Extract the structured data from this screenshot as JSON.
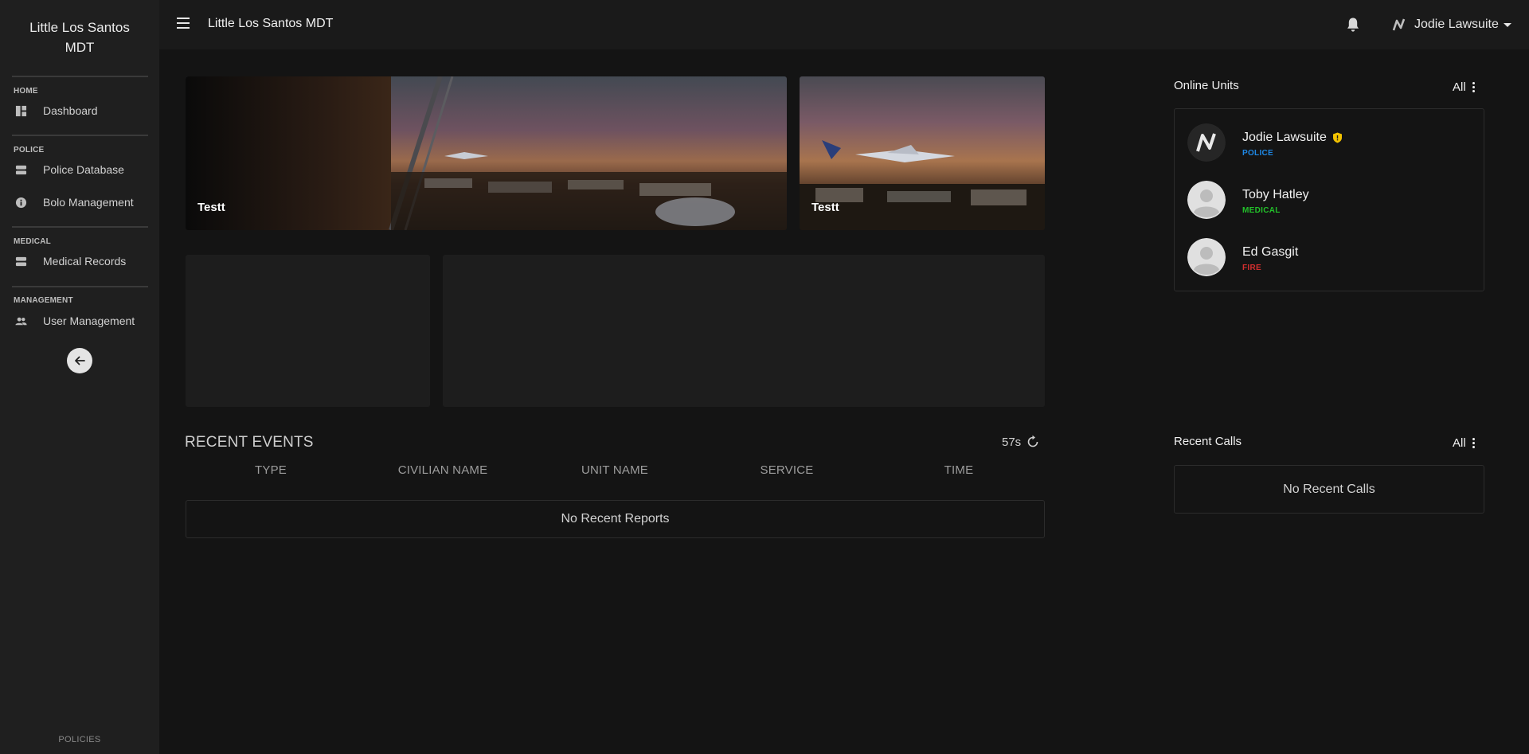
{
  "app": {
    "brand": "Little Los Santos MDT",
    "topbar_title": "Little Los Santos MDT"
  },
  "sidebar": {
    "sections": [
      {
        "title": "HOME",
        "items": [
          {
            "label": "Dashboard",
            "icon": "dashboard-icon"
          }
        ]
      },
      {
        "title": "POLICE",
        "items": [
          {
            "label": "Police Database",
            "icon": "database-icon"
          },
          {
            "label": "Bolo Management",
            "icon": "info-icon"
          }
        ]
      },
      {
        "title": "MEDICAL",
        "items": [
          {
            "label": "Medical Records",
            "icon": "database-icon"
          }
        ]
      },
      {
        "title": "MANAGEMENT",
        "items": [
          {
            "label": "User Management",
            "icon": "users-icon"
          }
        ]
      }
    ],
    "collapse_icon": "arrow-left-icon",
    "footer": "POLICIES"
  },
  "user": {
    "name": "Jodie Lawsuite"
  },
  "banners": [
    {
      "caption": "Testt"
    },
    {
      "caption": "Testt"
    }
  ],
  "recent_events": {
    "title": "RECENT EVENTS",
    "timer": "57s",
    "columns": [
      "TYPE",
      "CIVILIAN NAME",
      "UNIT NAME",
      "SERVICE",
      "TIME"
    ],
    "empty": "No Recent Reports"
  },
  "online_units": {
    "title": "Online Units",
    "filter": "All",
    "units": [
      {
        "name": "Jodie Lawsuite",
        "role": "POLICE",
        "role_color": "#1e88e5",
        "badge": "shield-icon",
        "avatar": "brand-logo"
      },
      {
        "name": "Toby Hatley",
        "role": "MEDICAL",
        "role_color": "#22c02a",
        "avatar": "default-avatar"
      },
      {
        "name": "Ed Gasgit",
        "role": "FIRE",
        "role_color": "#d32f2f",
        "avatar": "default-avatar"
      }
    ]
  },
  "recent_calls": {
    "title": "Recent Calls",
    "filter": "All",
    "empty": "No Recent Calls"
  },
  "colors": {
    "background": "#141414",
    "sidebar": "#1f1f1f",
    "topbar": "#1a1a1a",
    "badge": "#f2c200"
  }
}
